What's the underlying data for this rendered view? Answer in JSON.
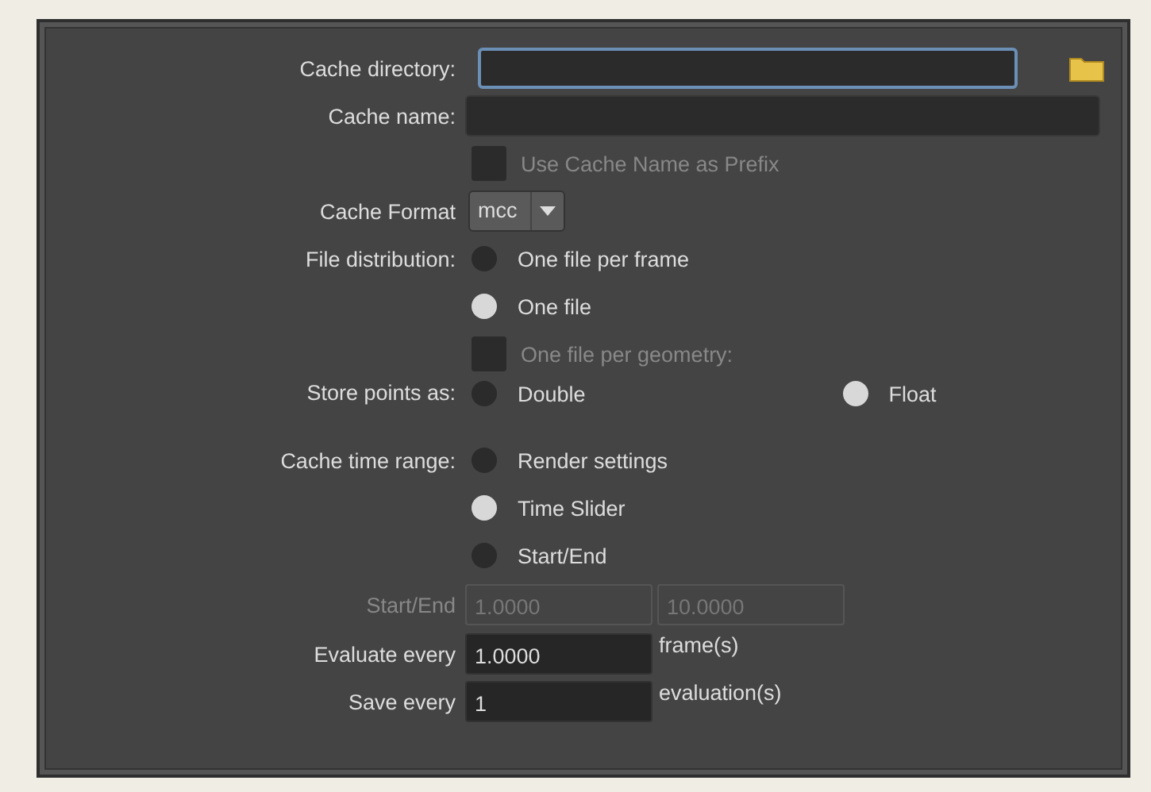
{
  "rows": [
    {
      "kind": "path_field",
      "label": "Cache directory:",
      "focused": true
    },
    {
      "kind": "text_field",
      "label": "Cache name:"
    },
    {
      "kind": "checkbox",
      "text": "Use Cache Name as Prefix",
      "checked": false,
      "disabled": true
    },
    {
      "kind": "dropdown",
      "label": "Cache Format",
      "value": "mcc"
    },
    {
      "kind": "radio",
      "label": "File distribution:",
      "text": "One file per frame",
      "selected": false
    },
    {
      "kind": "radio",
      "text": "One file",
      "selected": true
    },
    {
      "kind": "checkbox",
      "text": "One file per geometry:",
      "checked": false,
      "disabled": true
    },
    {
      "kind": "radio_pair",
      "label": "Store points as:",
      "options": [
        {
          "text": "Double",
          "selected": false
        },
        {
          "text": "Float",
          "selected": true
        }
      ]
    },
    {
      "kind": "radio",
      "label": "Cache time range:",
      "text": "Render settings",
      "selected": false
    },
    {
      "kind": "radio",
      "text": "Time Slider",
      "selected": true
    },
    {
      "kind": "radio",
      "text": "Start/End",
      "selected": false
    },
    {
      "kind": "range",
      "label": "Start/End",
      "disabled": true,
      "values": [
        "1.0000",
        "10.0000"
      ]
    },
    {
      "kind": "number",
      "label": "Evaluate every",
      "value": "1.0000",
      "unit": "frame(s)"
    },
    {
      "kind": "number",
      "label": "Save every",
      "value": "1",
      "unit": "evaluation(s)"
    }
  ]
}
